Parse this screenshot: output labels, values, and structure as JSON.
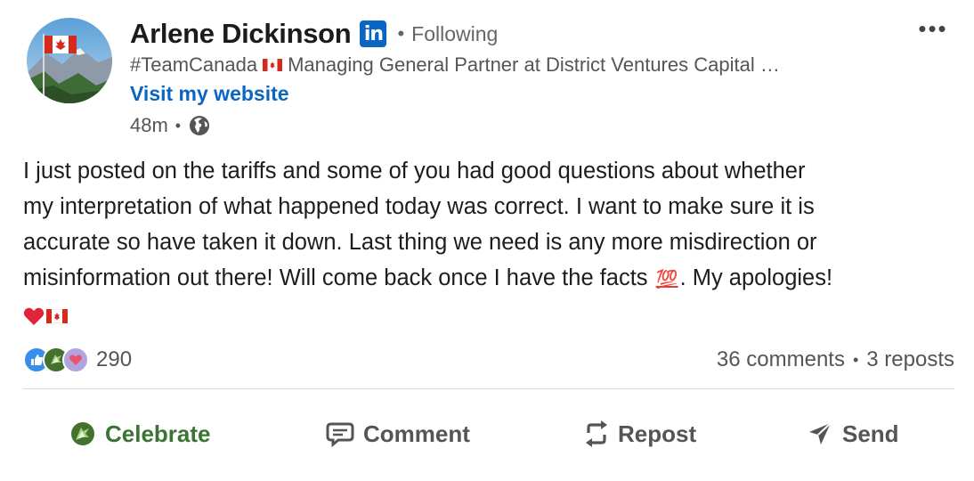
{
  "author": {
    "name": "Arlene Dickinson",
    "badge_text": "in",
    "follow_status": "Following",
    "headline_prefix": "#TeamCanada",
    "headline_rest": "Managing General Partner at District Ventures Capital …",
    "website_label": "Visit my website",
    "posted_time": "48m",
    "visibility_icon": "globe-icon"
  },
  "post": {
    "lines": [
      "I just posted on the tariffs and some of you had good questions about whether",
      "my interpretation of what happened today was correct. I want to make sure it is",
      "accurate so have taken it down. Last thing we need is any more misdirection or",
      "misinformation out there!  Will come back once I have the facts",
      ". My apologies!"
    ],
    "emoji_100": "💯"
  },
  "reactions": {
    "count": "290",
    "icons": [
      "like-icon",
      "celebrate-icon",
      "love-icon"
    ]
  },
  "stats": {
    "comments": "36 comments",
    "reposts": "3 reposts"
  },
  "actions": {
    "celebrate": "Celebrate",
    "comment": "Comment",
    "repost": "Repost",
    "send": "Send"
  },
  "colors": {
    "link_blue": "#0a66c2",
    "celebrate_green": "#3a7434",
    "text_gray": "#555555"
  }
}
